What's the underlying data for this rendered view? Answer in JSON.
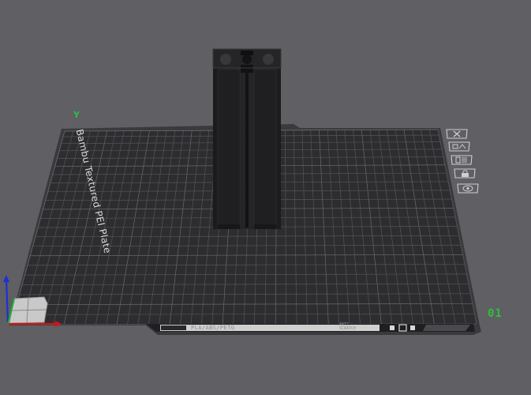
{
  "plate": {
    "name": "Bambu Textured PEI Plate",
    "number": "01",
    "strip_text": "PLA/ABS/PETG",
    "strip_sub_top": "ANTI",
    "strip_sub_bottom": "SCRATCH"
  },
  "axis": {
    "y_label": "Y"
  },
  "plate_toolbar": {
    "items": [
      {
        "icon": "close-icon"
      },
      {
        "icon": "auto-orient-icon"
      },
      {
        "icon": "arrange-icon"
      },
      {
        "icon": "lock-icon"
      },
      {
        "icon": "eye-icon"
      }
    ]
  },
  "colors": {
    "background": "#5f5f64",
    "plate": "#2e2e30",
    "grid": "#5a5a5e",
    "model": "#1e1e20",
    "axis_x": "#d01616",
    "axis_y": "#15b02e",
    "axis_z": "#1d2fd6",
    "plate_number": "#2fbf3d"
  }
}
